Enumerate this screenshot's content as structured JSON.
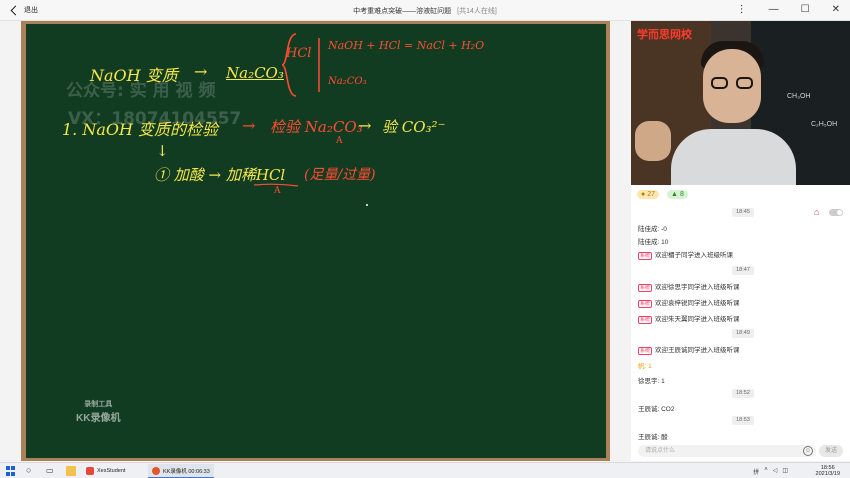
{
  "window": {
    "back_label": "退出",
    "title": "中考重难点突破——溶液缸问题",
    "online": "[共14人在线]",
    "controls": [
      "⋮",
      "—",
      "☐",
      "✕"
    ]
  },
  "board": {
    "lines": {
      "naoh_spoil": "NaOH 变质",
      "arrow1": "→",
      "na2co3": "Na₂CO₃",
      "hcl": "HCl",
      "eq1": "NaOH + HCl = NaCl + H₂O",
      "eq2": "Na₂CO₃",
      "item1": "1. NaOH 变质的检验",
      "arrow2": "→",
      "test_na2co3": "检验 Na₂CO₃",
      "arrow3": "→",
      "test_co3": "验 CO₃²⁻",
      "down": "↓",
      "step1": "① 加酸 → 加稀HCl",
      "step1_note": "(足量/过量)",
      "mark_a": "A"
    },
    "watermark": {
      "line1": "公众号: 实 用 视 频",
      "line2": "VX：18074104557"
    },
    "recorder": {
      "line1": "录制工具",
      "line2": "KK录像机"
    }
  },
  "video": {
    "overlay": "学而思网校",
    "chem_labels": [
      "CH₃OH",
      "C₂H₅OH"
    ]
  },
  "badges": {
    "gold": "27",
    "green": "8"
  },
  "chat": {
    "sys_tag": "系统",
    "messages": [
      {
        "type": "time",
        "text": "18:45"
      },
      {
        "type": "text",
        "text": "陆佳成: -0"
      },
      {
        "type": "text",
        "text": "陆佳成: 10"
      },
      {
        "type": "sys",
        "text": "欢迎楣子同学进入班级听课"
      },
      {
        "type": "time",
        "text": "18:47"
      },
      {
        "type": "sys",
        "text": "欢迎徐思宇同学进入班级听课"
      },
      {
        "type": "sys",
        "text": "欢迎袁梓锐同学进入班级听课"
      },
      {
        "type": "sys",
        "text": "欢迎朱天翼同学进入班级听课"
      },
      {
        "type": "time",
        "text": "18:49"
      },
      {
        "type": "sys",
        "text": "欢迎王辰诚同学进入班级听课"
      },
      {
        "type": "text",
        "text": "帆: 1"
      },
      {
        "type": "text",
        "text": "徐思宇: 1"
      },
      {
        "type": "time",
        "text": "18:52"
      },
      {
        "type": "text",
        "text": "王辰诚: CO2"
      },
      {
        "type": "time",
        "text": "18:53"
      },
      {
        "type": "text",
        "text": "王辰诚: 酸"
      }
    ],
    "input_placeholder": "请说点什么",
    "send_label": "发送"
  },
  "taskbar": {
    "apps": [
      {
        "label": "XesStudent"
      },
      {
        "label": "KK录像机 00:06:33"
      }
    ],
    "tray_lang": "拼",
    "clock_time": "18:56",
    "clock_date": "2021/3/19"
  },
  "colors": {
    "board": "#123c22",
    "chalk_yellow": "#f5e64a",
    "chalk_red": "#ff4b33",
    "frame": "#a9825a"
  }
}
